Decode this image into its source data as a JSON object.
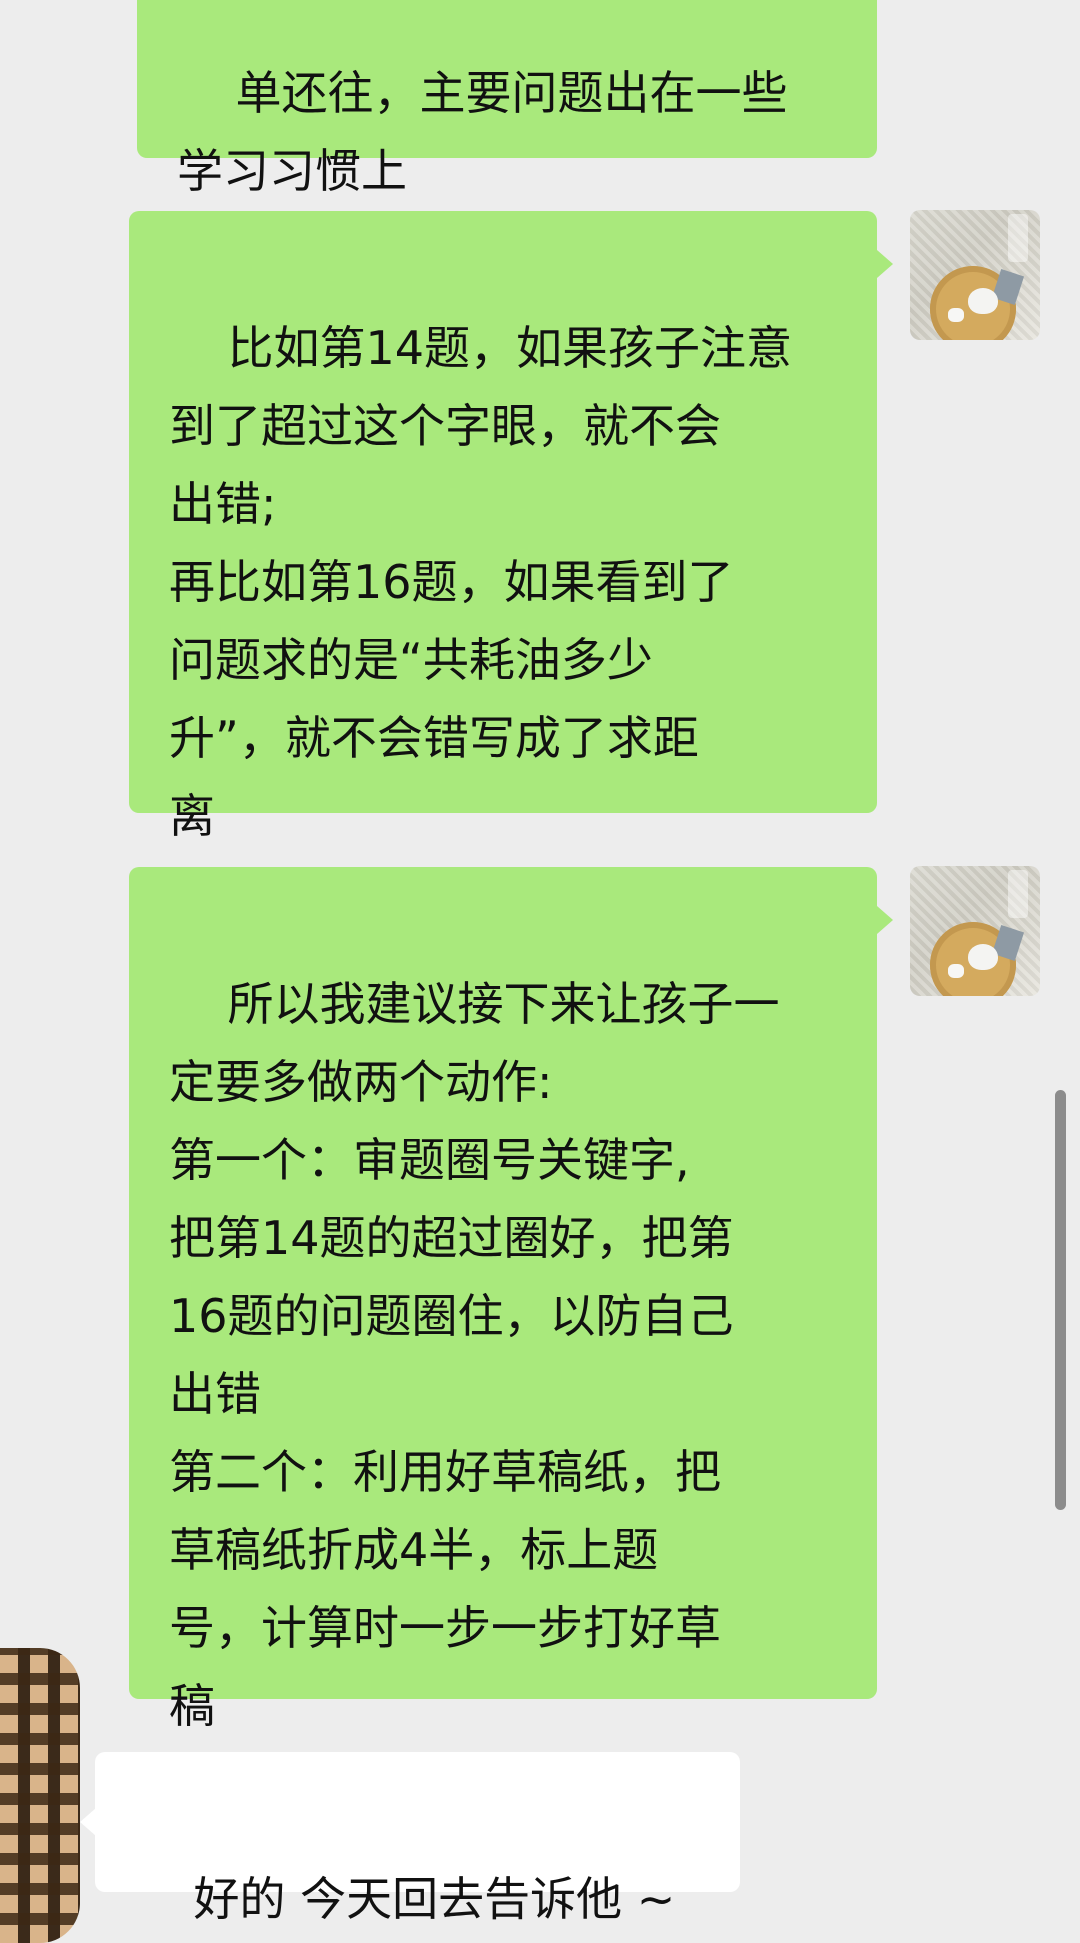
{
  "messages": [
    {
      "sender": "me",
      "text": "单还往，主要问题出在一些\n学习习惯上"
    },
    {
      "sender": "me",
      "text": "比如第14题，如果孩子注意\n到了超过这个字眼，就不会\n出错;\n再比如第16题，如果看到了\n问题求的是“共耗油多少\n升”，就不会错写成了求距\n离"
    },
    {
      "sender": "me",
      "text": "所以我建议接下来让孩子一\n定要多做两个动作:\n第一个：审题圈号关键字,\n把第14题的超过圈好，把第\n16题的问题圈住，以防自己\n出错\n第二个：利用好草稿纸，把\n草稿纸折成4半，标上题\n号，计算时一步一步打好草\n稿"
    },
    {
      "sender": "other",
      "text": "好的 今天回去告诉他 ~"
    }
  ],
  "colors": {
    "background": "#ededed",
    "outgoing_bubble": "#a9e97c",
    "incoming_bubble": "#ffffff"
  }
}
